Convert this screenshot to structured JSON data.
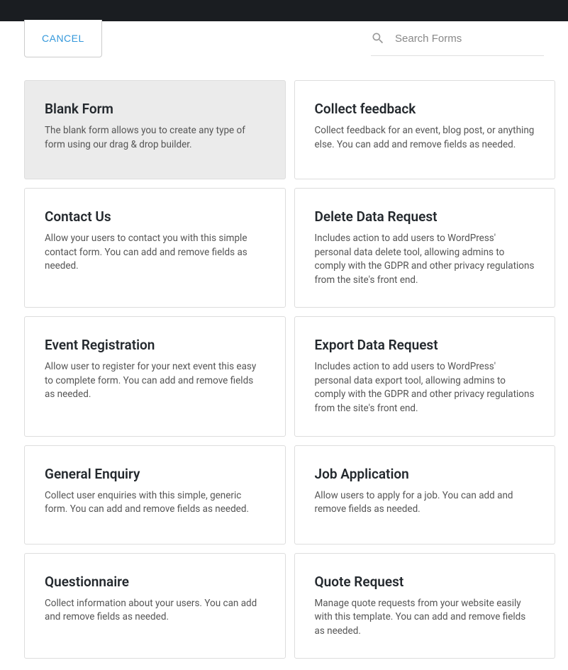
{
  "header": {
    "cancel_label": "CANCEL",
    "search_placeholder": "Search Forms"
  },
  "cards": [
    {
      "title": "Blank Form",
      "desc": "The blank form allows you to create any type of form using our drag & drop builder.",
      "selected": true
    },
    {
      "title": "Collect feedback",
      "desc": "Collect feedback for an event, blog post, or anything else. You can add and remove fields as needed.",
      "selected": false
    },
    {
      "title": "Contact Us",
      "desc": "Allow your users to contact you with this simple contact form. You can add and remove fields as needed.",
      "selected": false
    },
    {
      "title": "Delete Data Request",
      "desc": "Includes action to add users to WordPress' personal data delete tool, allowing admins to comply with the GDPR and other privacy regulations from the site's front end.",
      "selected": false
    },
    {
      "title": "Event Registration",
      "desc": "Allow user to register for your next event this easy to complete form. You can add and remove fields as needed.",
      "selected": false
    },
    {
      "title": "Export Data Request",
      "desc": "Includes action to add users to WordPress' personal data export tool, allowing admins to comply with the GDPR and other privacy regulations from the site's front end.",
      "selected": false
    },
    {
      "title": "General Enquiry",
      "desc": "Collect user enquiries with this simple, generic form. You can add and remove fields as needed.",
      "selected": false
    },
    {
      "title": "Job Application",
      "desc": "Allow users to apply for a job. You can add and remove fields as needed.",
      "selected": false
    },
    {
      "title": "Questionnaire",
      "desc": "Collect information about your users. You can add and remove fields as needed.",
      "selected": false
    },
    {
      "title": "Quote Request",
      "desc": "Manage quote requests from your website easily with this template. You can add and remove fields as needed.",
      "selected": false
    }
  ]
}
